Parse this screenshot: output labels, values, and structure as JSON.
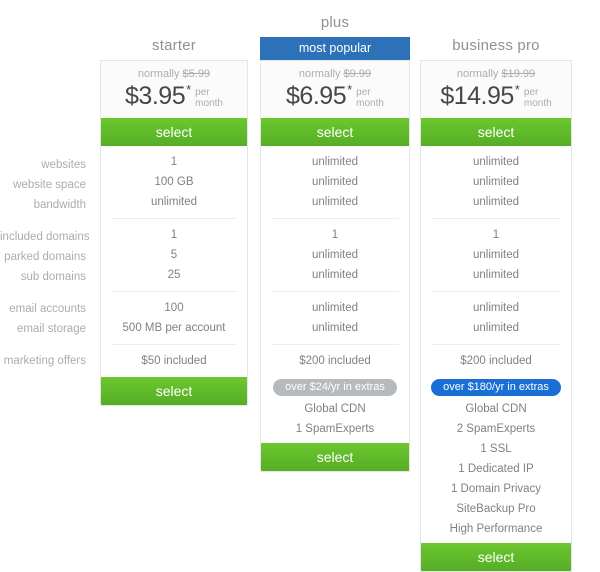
{
  "feature_labels": [
    [
      "websites",
      "website space",
      "bandwidth"
    ],
    [
      "included domains",
      "parked domains",
      "sub domains"
    ],
    [
      "email accounts",
      "email storage"
    ],
    [
      "marketing offers"
    ]
  ],
  "colors": {
    "green": "#5cb82c",
    "blue": "#2d72b8",
    "pill_gray": "#b6babd",
    "pill_blue": "#1a6fd4",
    "card_border": "#e3e5e6",
    "label_text": "#a9adb1",
    "value_text": "#7d8286"
  },
  "plans": {
    "starter": {
      "title": "starter",
      "normally_prefix": "normally",
      "normally_price": "$5.99",
      "price": "$3.95",
      "star": "*",
      "per": "per",
      "month": "month",
      "select_label": "select",
      "select_label_bottom": "select",
      "groups": [
        [
          "1",
          "100 GB",
          "unlimited"
        ],
        [
          "1",
          "5",
          "25"
        ],
        [
          "100",
          "500 MB per account"
        ],
        [
          "$50 included"
        ]
      ],
      "extras_pill": "",
      "extras": []
    },
    "plus": {
      "title": "plus",
      "badge": "most popular",
      "normally_prefix": "normally",
      "normally_price": "$9.99",
      "price": "$6.95",
      "star": "*",
      "per": "per",
      "month": "month",
      "select_label": "select",
      "select_label_bottom": "select",
      "groups": [
        [
          "unlimited",
          "unlimited",
          "unlimited"
        ],
        [
          "1",
          "unlimited",
          "unlimited"
        ],
        [
          "unlimited",
          "unlimited"
        ],
        [
          "$200 included"
        ]
      ],
      "extras_pill": "over $24/yr in extras",
      "extras": [
        "Global CDN",
        "1 SpamExperts"
      ]
    },
    "business_pro": {
      "title": "business pro",
      "normally_prefix": "normally",
      "normally_price": "$19.99",
      "price": "$14.95",
      "star": "*",
      "per": "per",
      "month": "month",
      "select_label": "select",
      "select_label_bottom": "select",
      "groups": [
        [
          "unlimited",
          "unlimited",
          "unlimited"
        ],
        [
          "1",
          "unlimited",
          "unlimited"
        ],
        [
          "unlimited",
          "unlimited"
        ],
        [
          "$200 included"
        ]
      ],
      "extras_pill": "over $180/yr in extras",
      "extras": [
        "Global CDN",
        "2 SpamExperts",
        "1 SSL",
        "1 Dedicated IP",
        "1 Domain Privacy",
        "SiteBackup Pro",
        "High Performance"
      ]
    }
  }
}
